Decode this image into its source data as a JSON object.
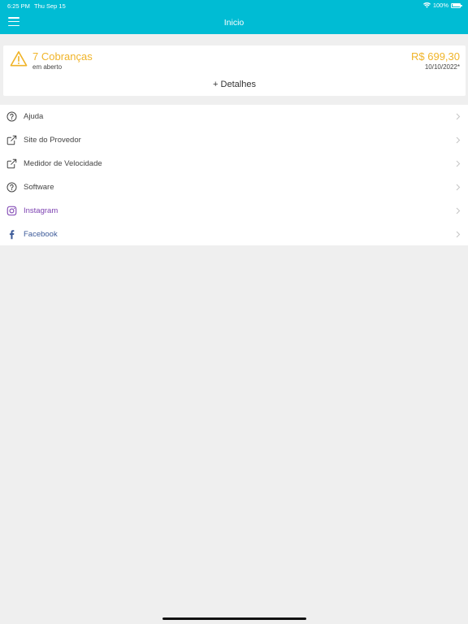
{
  "status_bar": {
    "time": "6:25 PM",
    "date": "Thu Sep 15",
    "battery": "100%"
  },
  "header": {
    "title": "Inicio"
  },
  "charges_card": {
    "title": "7 Cobranças",
    "subtitle": "em aberto",
    "amount": "R$ 699,30",
    "due_date": "10/10/2022*",
    "details_label": "+ Detalhes"
  },
  "menu": {
    "items": [
      {
        "label": "Ajuda",
        "icon": "help-circle-icon"
      },
      {
        "label": "Site do Provedor",
        "icon": "external-link-icon"
      },
      {
        "label": "Medidor de Velocidade",
        "icon": "external-link-icon"
      },
      {
        "label": "Software",
        "icon": "help-circle-icon"
      },
      {
        "label": "Instagram",
        "icon": "instagram-icon"
      },
      {
        "label": "Facebook",
        "icon": "facebook-icon"
      }
    ]
  },
  "colors": {
    "header": "#00bcd4",
    "warning": "#f0b429",
    "instagram": "#7b3fb0",
    "facebook": "#3b5998",
    "background": "#efefef"
  }
}
